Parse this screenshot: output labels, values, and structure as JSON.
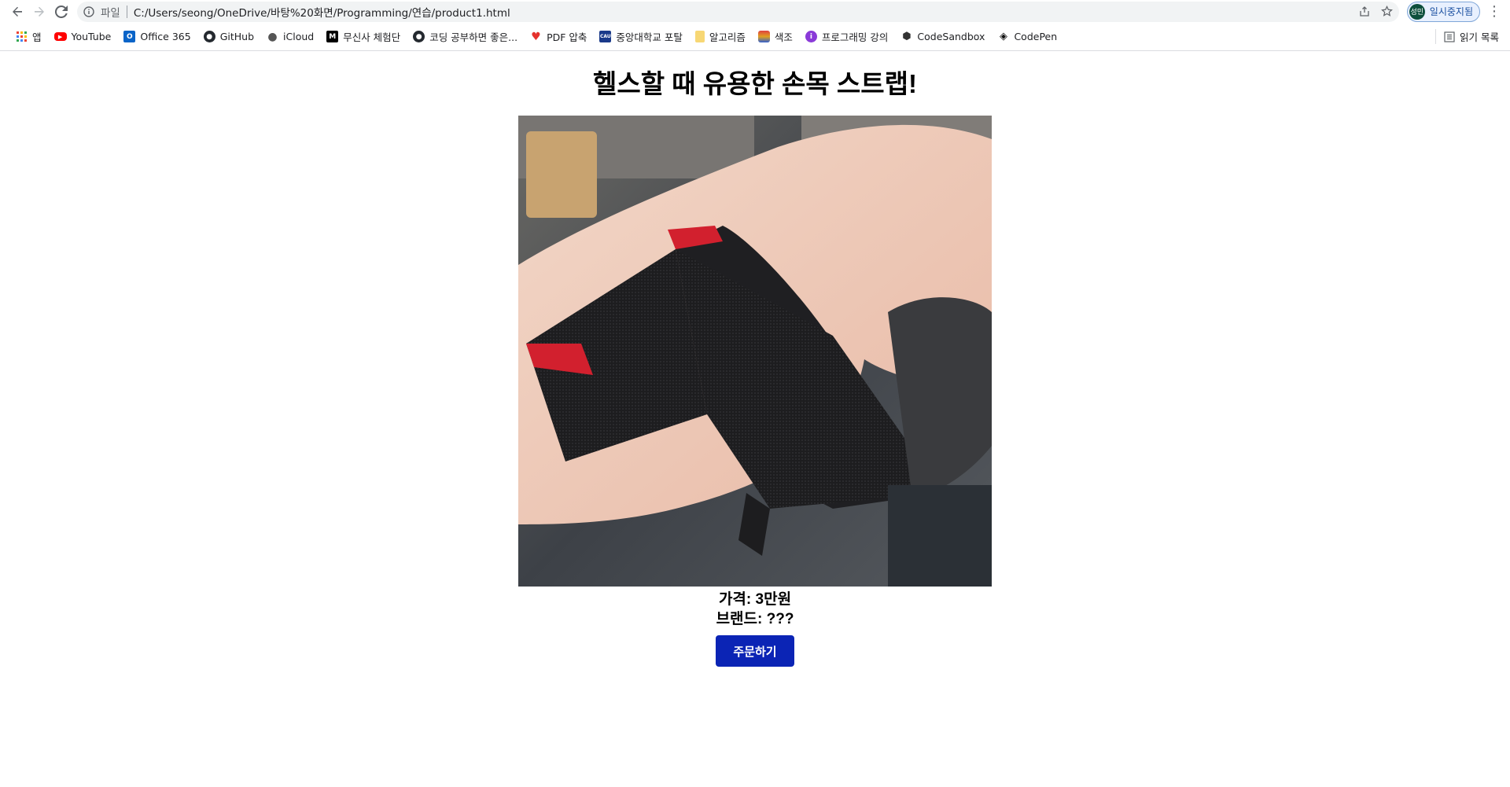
{
  "browser": {
    "scheme_label": "파일",
    "url": "C:/Users/seong/OneDrive/바탕%20화면/Programming/연습/product1.html",
    "profile_initials": "성민",
    "profile_status": "일시중지됨",
    "reading_list_label": "읽기 목록"
  },
  "bookmarks": [
    {
      "label": "앱",
      "icon": "apps-grid-icon"
    },
    {
      "label": "YouTube",
      "icon": "youtube-icon",
      "color": "#ff0000"
    },
    {
      "label": "Office 365",
      "icon": "outlook-icon",
      "color": "#0a64c8"
    },
    {
      "label": "GitHub",
      "icon": "github-icon",
      "color": "#24292f"
    },
    {
      "label": "iCloud",
      "icon": "apple-icon",
      "color": "#555555"
    },
    {
      "label": "무신사 체험단",
      "icon": "musinsa-icon",
      "color": "#000000"
    },
    {
      "label": "코딩 공부하면 좋은...",
      "icon": "github-icon",
      "color": "#24292f"
    },
    {
      "label": "PDF 압축",
      "icon": "heart-icon",
      "color": "#e5322d"
    },
    {
      "label": "중앙대학교 포탈",
      "icon": "cau-icon",
      "color": "#1a3a8a"
    },
    {
      "label": "알고리즘",
      "icon": "folder-icon",
      "color": "#f7d774"
    },
    {
      "label": "색조",
      "icon": "color-icon",
      "color": "#e0a020"
    },
    {
      "label": "프로그래밍 강의",
      "icon": "lecture-icon",
      "color": "#8a3ad8"
    },
    {
      "label": "CodeSandbox",
      "icon": "codesandbox-icon",
      "color": "#333333"
    },
    {
      "label": "CodePen",
      "icon": "codepen-icon",
      "color": "#111111"
    }
  ],
  "page": {
    "title": "헬스할 때 유용한 손목 스트랩!",
    "price_line": "가격: 3만원",
    "brand_line": "브랜드: ???",
    "order_button": "주문하기",
    "button_color": "#0b24b5"
  }
}
